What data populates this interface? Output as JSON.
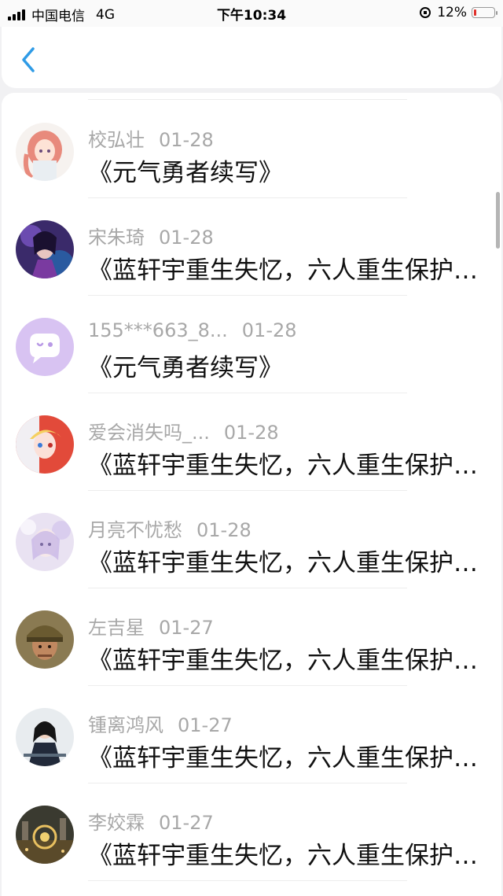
{
  "status_bar": {
    "carrier": "中国电信",
    "network": "4G",
    "time": "下午10:34",
    "battery": "12%",
    "battery_level": 0.12
  },
  "header": {
    "back_icon": "chevron-left-icon"
  },
  "items": [
    {
      "user": "校弘壮",
      "date": "01-28",
      "title": "《元气勇者续写》",
      "avatar": "anime-girl-pink-hair"
    },
    {
      "user": "宋朱琦",
      "date": "01-28",
      "title": "《蓝轩宇重生失忆，六人重生保护蓝轩宇》",
      "avatar": "fantasy-warrior-purple"
    },
    {
      "user": "155***663_8...",
      "date": "01-28",
      "title": "《元气勇者续写》",
      "avatar": "default-chat-bubble"
    },
    {
      "user": "爱会消失吗_...",
      "date": "01-28",
      "title": "《蓝轩宇重生失忆，六人重生保护蓝轩宇》",
      "avatar": "anime-red-white-hair"
    },
    {
      "user": "月亮不忧愁",
      "date": "01-28",
      "title": "《蓝轩宇重生失忆，六人重生保护蓝轩宇》",
      "avatar": "anime-lavender-girl"
    },
    {
      "user": "左吉星",
      "date": "01-27",
      "title": "《蓝轩宇重生失忆，六人重生保护蓝轩宇》",
      "avatar": "soldier-helmet"
    },
    {
      "user": "锺离鸿风",
      "date": "01-27",
      "title": "《蓝轩宇重生失忆，六人重生保护蓝轩宇》",
      "avatar": "girl-black-hair"
    },
    {
      "user": "李姣霖",
      "date": "01-27",
      "title": "《蓝轩宇重生失忆，六人重生保护蓝轩宇》",
      "avatar": "night-city-aerial"
    }
  ]
}
